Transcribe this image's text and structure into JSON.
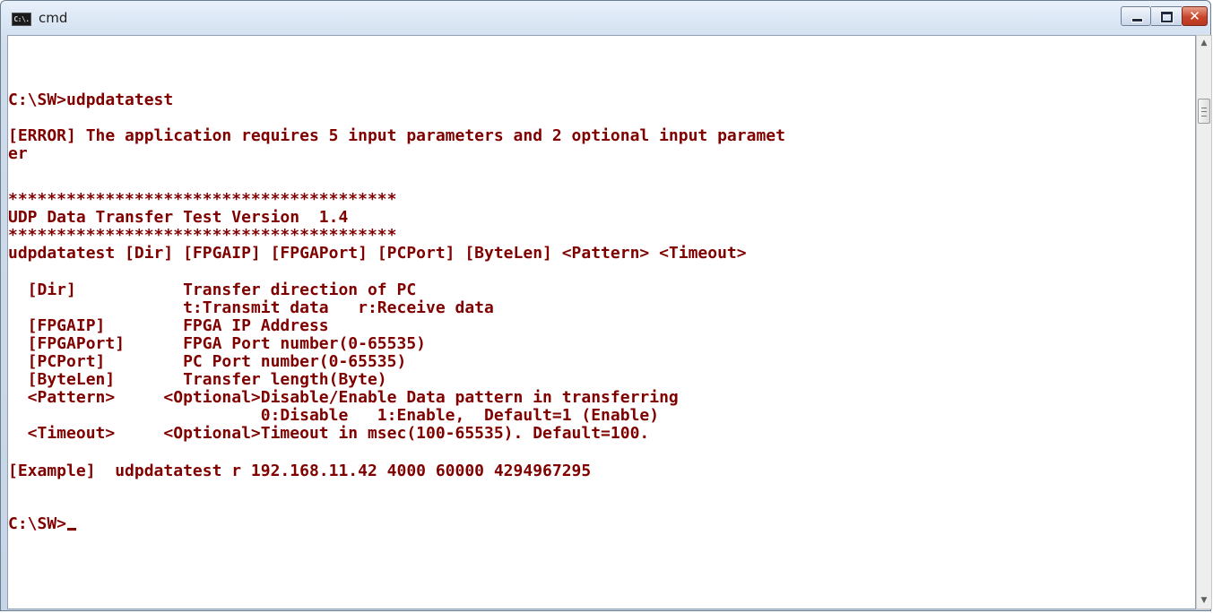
{
  "window": {
    "title": "cmd",
    "icon": "console-icon",
    "icon_label": "C:\\."
  },
  "terminal": {
    "text_color": "#800000",
    "background": "#ffffff",
    "lines": [
      "C:\\SW>udpdatatest",
      "[ERROR] The application requires 5 input parameters and 2 optional input paramet",
      "er",
      "****************************************",
      "UDP Data Transfer Test Version  1.4",
      "****************************************",
      "udpdatatest [Dir] [FPGAIP] [FPGAPort] [PCPort] [ByteLen] <Pattern> <Timeout>",
      "  [Dir]           Transfer direction of PC",
      "                  t:Transmit data   r:Receive data",
      "  [FPGAIP]        FPGA IP Address",
      "  [FPGAPort]      FPGA Port number(0-65535)",
      "  [PCPort]        PC Port number(0-65535)",
      "  [ByteLen]       Transfer length(Byte)",
      "  <Pattern>     <Optional>Disable/Enable Data pattern in transferring",
      "                          0:Disable   1:Enable,  Default=1 (Enable)",
      "  <Timeout>     <Optional>Timeout in msec(100-65535). Default=100.",
      "[Example]  udpdatatest r 192.168.11.42 4000 60000 4294967295",
      "C:\\SW>"
    ]
  }
}
